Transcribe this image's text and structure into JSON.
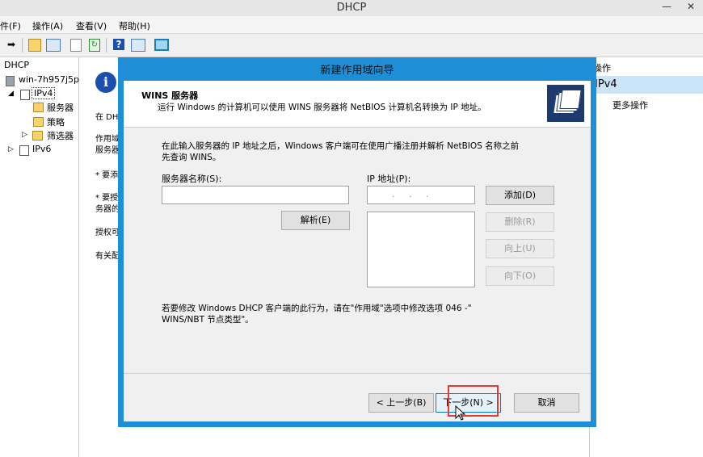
{
  "window": {
    "title": "DHCP",
    "minimize": "—",
    "close": "✕"
  },
  "menu": [
    "件(F)",
    "操作(A)",
    "查看(V)",
    "帮助(H)"
  ],
  "tree": {
    "root": "DHCP",
    "server": "win-7h957j5p",
    "ipv4": "IPv4",
    "server_options": "服务器",
    "policies": "策略",
    "filters": "筛选器",
    "ipv6": "IPv6"
  },
  "content_lines": [
    "在 DH",
    "作用域",
    "服务器",
    "* 要添",
    "* 要授",
    "务器的",
    "授权可",
    "有关配"
  ],
  "actions": {
    "header": "操作",
    "selected": "IPv4",
    "more": "更多操作"
  },
  "dialog": {
    "title": "新建作用域向导",
    "section_title": "WINS 服务器",
    "section_subtitle": "运行 Windows 的计算机可以使用 WINS 服务器将 NetBIOS 计算机名转换为 IP 地址。",
    "instruction_line1": "在此输入服务器的 IP 地址之后，Windows 客户端可在使用广播注册并解析 NetBIOS 名称之前",
    "instruction_line2": "先查询 WINS。",
    "server_name_label": "服务器名称(S):",
    "server_name_value": "",
    "ip_label": "IP 地址(P):",
    "ip_value": ".     .     .",
    "resolve_button": "解析(E)",
    "add_button": "添加(D)",
    "remove_button": "删除(R)",
    "up_button": "向上(U)",
    "down_button": "向下(O)",
    "note_line1": "若要修改 Windows DHCP 客户端的此行为，请在\"作用域\"选项中修改选项 046 -\"",
    "note_line2": "WINS/NBT 节点类型\"。",
    "back_button": "< 上一步(B)",
    "next_button": "下一步(N) >",
    "cancel_button": "取消"
  },
  "colors": {
    "dialog_frame": "#1e8fd6",
    "highlight": "#e53935",
    "selection": "#cce4f7"
  }
}
